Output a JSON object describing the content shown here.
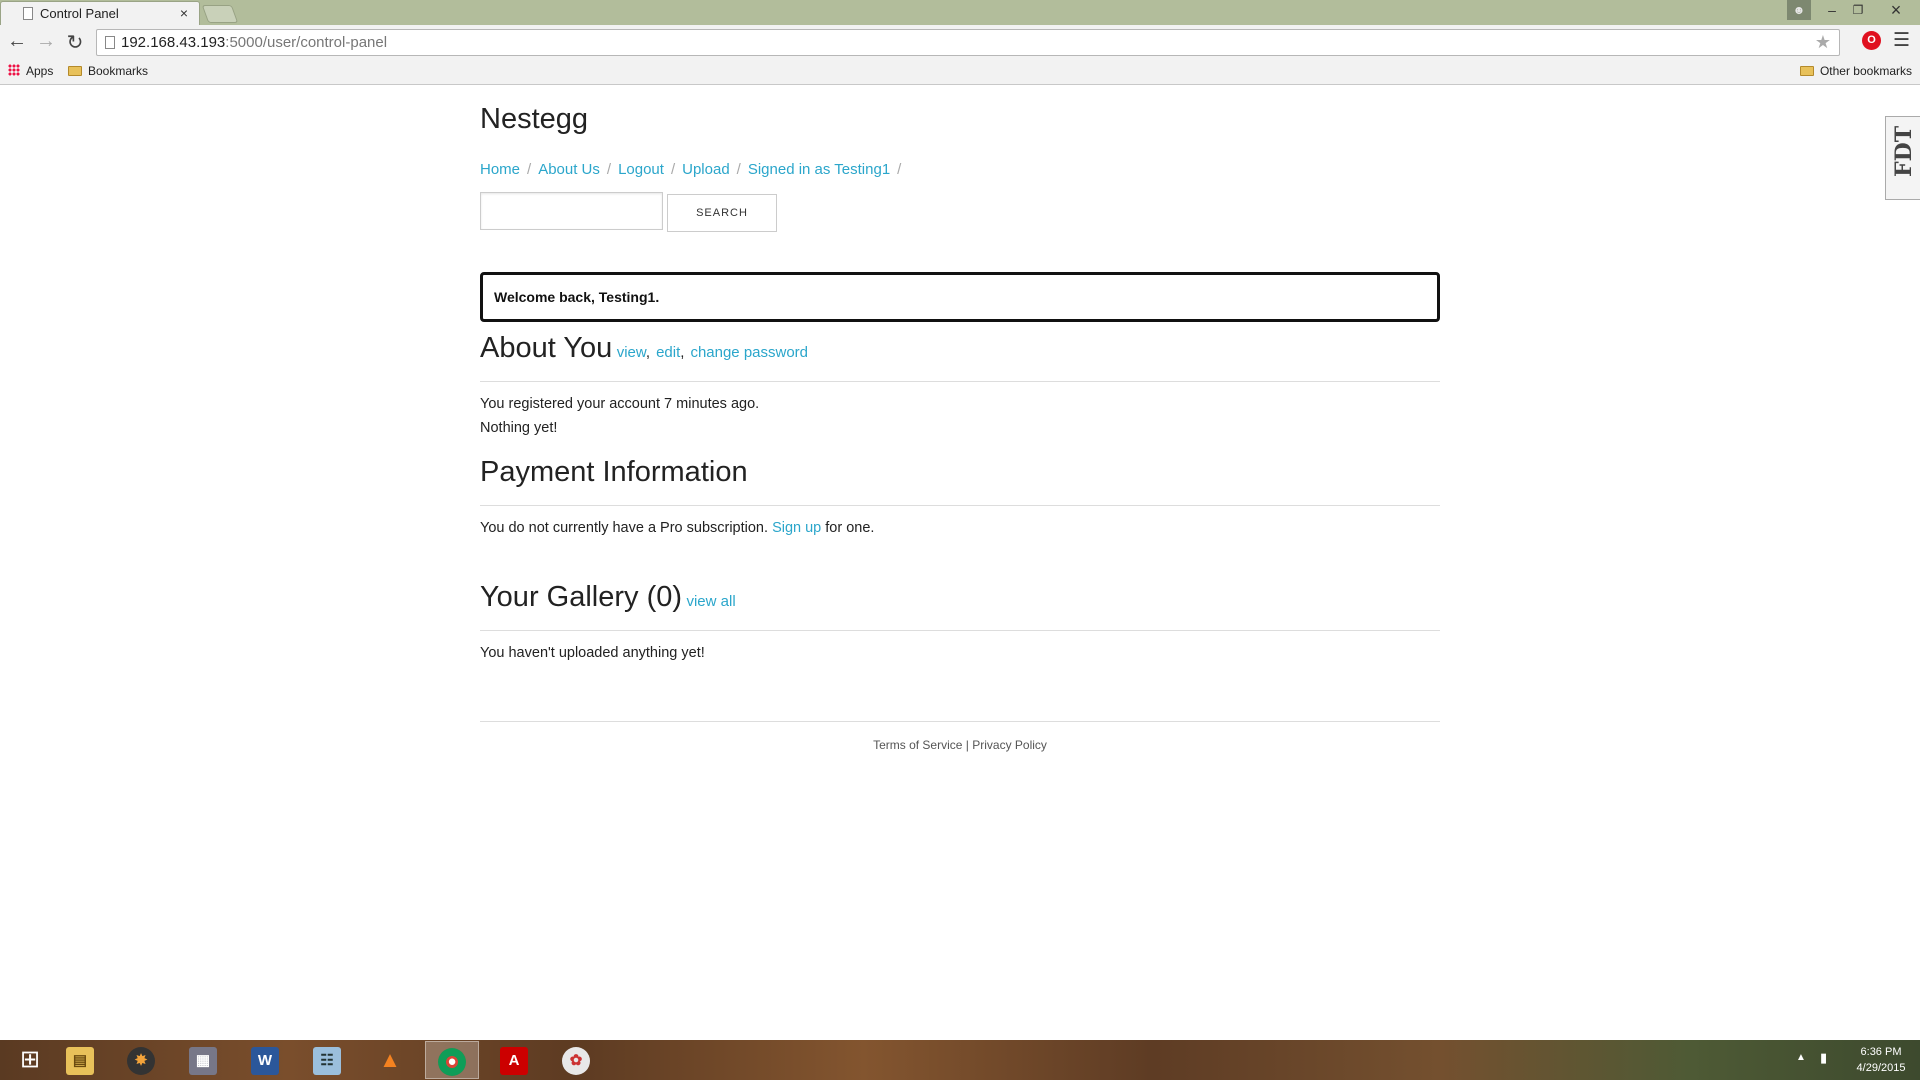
{
  "browser": {
    "tab_title": "Control Panel",
    "tab_close": "×",
    "url_host": "192.168.43.193",
    "url_rest": ":5000/user/control-panel",
    "bookmarks": {
      "apps": "Apps",
      "bookmarks": "Bookmarks",
      "other": "Other bookmarks"
    }
  },
  "site": {
    "title": "Nestegg",
    "nav": [
      {
        "label": "Home"
      },
      {
        "label": "About Us"
      },
      {
        "label": "Logout"
      },
      {
        "label": "Upload"
      },
      {
        "label": "Signed in as Testing1"
      }
    ],
    "search": {
      "value": "",
      "button_label": "SEARCH"
    },
    "welcome": "Welcome back, Testing1.",
    "about": {
      "heading": "About You",
      "links": [
        "view",
        "edit",
        "change password"
      ],
      "registered": "You registered your account 7 minutes ago.",
      "nothing": "Nothing yet!"
    },
    "payment": {
      "heading": "Payment Information",
      "text_before": "You do not currently have a Pro subscription.",
      "link": "Sign up",
      "text_after": "for one."
    },
    "gallery": {
      "heading": "Your Gallery (0)",
      "link": "view all",
      "empty": "You haven't uploaded anything yet!"
    },
    "footer": {
      "terms": "Terms of Service",
      "separator": "|",
      "privacy": "Privacy Policy"
    }
  },
  "side_tab": "FDT",
  "taskbar": {
    "clock_time": "6:36 PM",
    "clock_date": "4/29/2015"
  },
  "colors": {
    "link": "#2ba6cb",
    "titlebar": "#b2bd9b"
  }
}
